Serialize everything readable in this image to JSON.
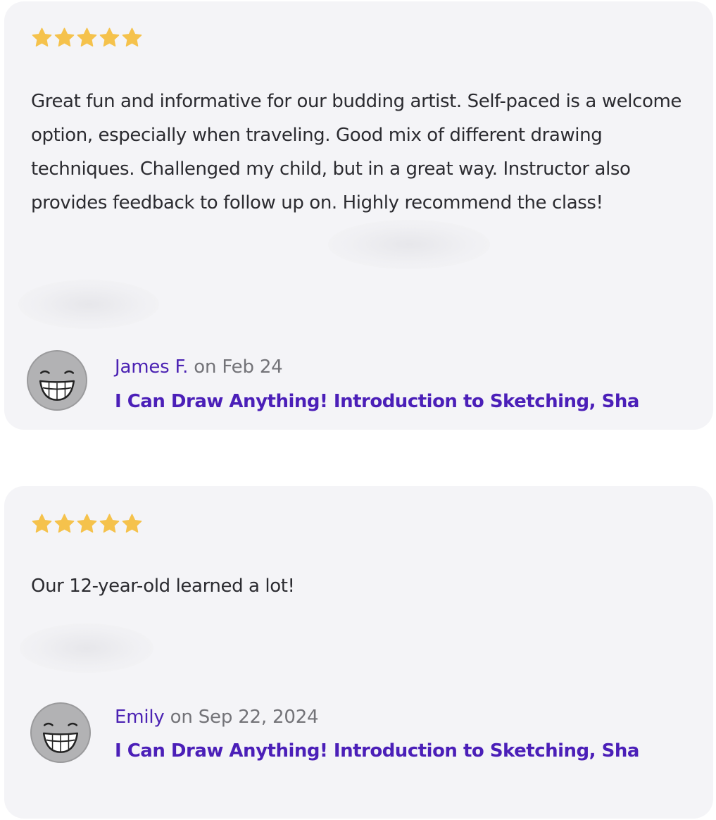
{
  "reviews": [
    {
      "rating": 5,
      "text": "Great fun and informative for our budding artist. Self-paced is a welcome option, especially when traveling. Good mix of different drawing techniques. Challenged my child, but in a great way. Instructor also provides feedback to follow up on. Highly recommend the class!",
      "author": "James F.",
      "date": "on Feb 24",
      "class_title": "I Can Draw Anything! Introduction to Sketching, Sha"
    },
    {
      "rating": 5,
      "text": "Our 12-year-old learned a lot!",
      "author": "Emily",
      "date": "on Sep 22, 2024",
      "class_title": "I Can Draw Anything! Introduction to Sketching, Sha"
    }
  ],
  "icons": {
    "star": "star-icon",
    "avatar": "smiling-face-avatar"
  },
  "colors": {
    "star": "#f5c24c",
    "card_background": "#f4f4f7",
    "link": "#4b1fb8",
    "author": "#4b22b3",
    "date": "#737378",
    "body_text": "#2b2b30",
    "avatar_fill": "#b2b2b4"
  }
}
